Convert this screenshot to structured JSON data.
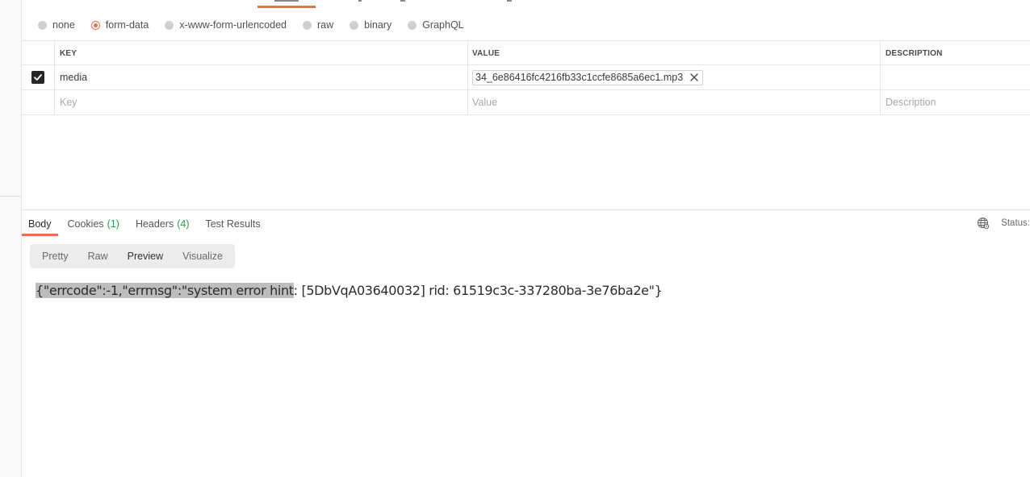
{
  "body_types": {
    "options": [
      {
        "label": "none",
        "selected": false
      },
      {
        "label": "form-data",
        "selected": true
      },
      {
        "label": "x-www-form-urlencoded",
        "selected": false
      },
      {
        "label": "raw",
        "selected": false
      },
      {
        "label": "binary",
        "selected": false
      },
      {
        "label": "GraphQL",
        "selected": false
      }
    ]
  },
  "params_table": {
    "headers": {
      "key": "KEY",
      "value": "VALUE",
      "description": "DESCRIPTION"
    },
    "rows": [
      {
        "checked": true,
        "key": "media",
        "value_file": "34_6e86416fc4216fb33c1ccfe8685a6ec1.mp3",
        "description": ""
      }
    ],
    "placeholders": {
      "key": "Key",
      "value": "Value",
      "description": "Description"
    }
  },
  "response": {
    "tabs": [
      {
        "label": "Body",
        "count": "",
        "active": true
      },
      {
        "label": "Cookies",
        "count": "(1)",
        "active": false
      },
      {
        "label": "Headers",
        "count": "(4)",
        "active": false
      },
      {
        "label": "Test Results",
        "count": "",
        "active": false
      }
    ],
    "status_label": "Status:",
    "view_modes": [
      "Pretty",
      "Raw",
      "Preview",
      "Visualize"
    ],
    "active_view_mode": "Preview",
    "body_selected": "{\"errcode\":-1,\"errmsg\":\"system error hint",
    "body_rest": ": [5DbVqA03640032] rid: 61519c3c-337280ba-3e76ba2e\"}"
  },
  "colors": {
    "accent": "#e8714a",
    "count_green": "#2e9a4b",
    "selection": "#bdbdbd"
  },
  "icons": [
    "checkbox-checked-icon",
    "remove-file-icon",
    "globe-icon"
  ]
}
